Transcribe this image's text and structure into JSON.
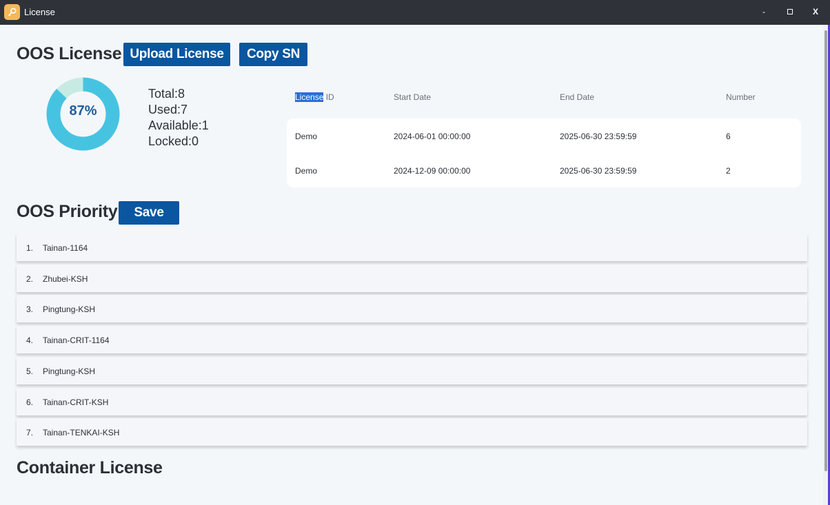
{
  "window": {
    "title": "License",
    "minimize": "-",
    "close": "X"
  },
  "oos_license": {
    "heading": "OOS License",
    "upload_button": "Upload License",
    "copy_sn_button": "Copy SN",
    "usage_percent_label": "87%",
    "usage_fraction": 0.87,
    "stats": {
      "total": "Total:8",
      "used": "Used:7",
      "available": "Available:1",
      "locked": "Locked:0"
    },
    "colors": {
      "used": "#47c3e2",
      "free": "#c7ebe3",
      "button": "#0a56a0"
    },
    "table": {
      "headers": {
        "license_id_selected": "License",
        "license_id_rest": " ID",
        "start": "Start Date",
        "end": "End Date",
        "number": "Number"
      },
      "rows": [
        {
          "id": "Demo",
          "start": "2024-06-01 00:00:00",
          "end": "2025-06-30 23:59:59",
          "number": "6"
        },
        {
          "id": "Demo",
          "start": "2024-12-09 00:00:00",
          "end": "2025-06-30 23:59:59",
          "number": "2"
        }
      ]
    }
  },
  "oos_priority": {
    "heading": "OOS Priority",
    "save_button": "Save",
    "items": [
      {
        "num": "1.",
        "name": "Tainan-1164"
      },
      {
        "num": "2.",
        "name": "Zhubei-KSH"
      },
      {
        "num": "3.",
        "name": "Pingtung-KSH"
      },
      {
        "num": "4.",
        "name": "Tainan-CRIT-1164"
      },
      {
        "num": "5.",
        "name": "Pingtung-KSH"
      },
      {
        "num": "6.",
        "name": "Tainan-CRIT-KSH"
      },
      {
        "num": "7.",
        "name": "Tainan-TENKAI-KSH"
      }
    ]
  },
  "container_license": {
    "heading": "Container License"
  }
}
